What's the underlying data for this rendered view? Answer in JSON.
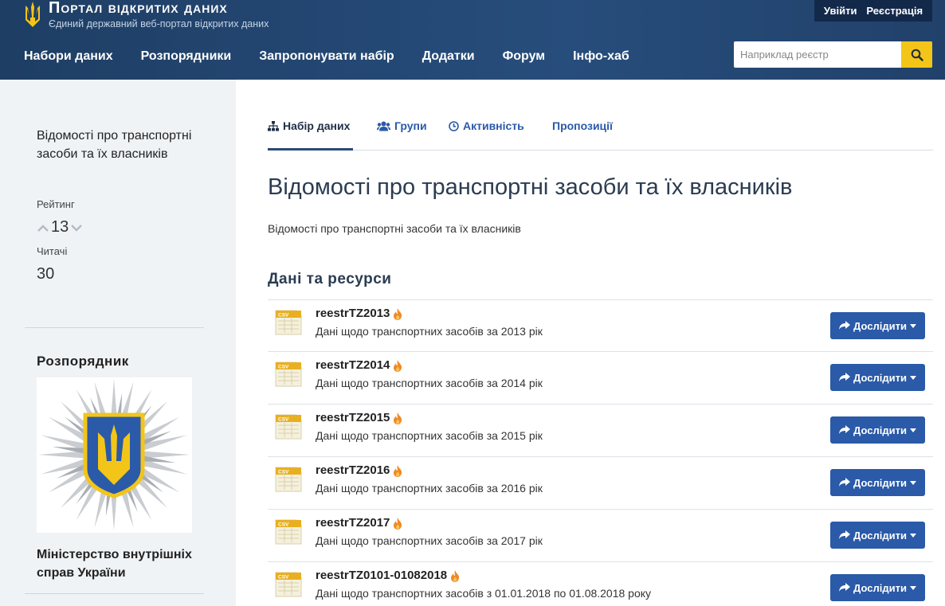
{
  "header": {
    "title": "Портал відкритих даних",
    "subtitle": "Єдиний державний веб-портал відкритих даних",
    "login": "Увійти",
    "register": "Реєстрація",
    "nav": [
      "Набори даних",
      "Розпорядники",
      "Запропонувати набір",
      "Додатки",
      "Форум",
      "Інфо-хаб"
    ],
    "search_placeholder": "Наприклад реєстр"
  },
  "sidebar": {
    "dataset_title": "Відомості про транспортні засоби та їх власників",
    "rating_label": "Рейтинг",
    "rating_value": "13",
    "readers_label": "Читачі",
    "readers_value": "30",
    "publisher_heading": "Розпорядник",
    "publisher_name": "Міністерство внутрішніх справ України"
  },
  "tabs": [
    {
      "label": "Набір даних",
      "icon": "sitemap-icon"
    },
    {
      "label": "Групи",
      "icon": "users-icon"
    },
    {
      "label": "Активність",
      "icon": "clock-icon"
    },
    {
      "label": "Пропозиції",
      "icon": ""
    }
  ],
  "main": {
    "title": "Відомості про транспортні засоби та їх власників",
    "description": "Відомості про транспортні засоби та їх власників",
    "resources_heading": "Дані та ресурси",
    "explore_label": "Дослідити",
    "file_format": "CSV",
    "resources": [
      {
        "name": "reestrTZ2013",
        "desc": "Дані щодо транспортних засобів за 2013 рік"
      },
      {
        "name": "reestrTZ2014",
        "desc": "Дані щодо транспортних засобів за 2014 рік"
      },
      {
        "name": "reestrTZ2015",
        "desc": "Дані щодо транспортних засобів за 2015 рік"
      },
      {
        "name": "reestrTZ2016",
        "desc": "Дані щодо транспортних засобів за 2016 рік"
      },
      {
        "name": "reestrTZ2017",
        "desc": "Дані щодо транспортних засобів за 2017 рік"
      },
      {
        "name": "reestrTZ0101-01082018",
        "desc": "Дані щодо транспортних засобів з 01.01.2018 по 01.08.2018 року"
      }
    ]
  },
  "colors": {
    "header_bg": "#21416a",
    "accent": "#2a5aa8",
    "search_button": "#f2c518",
    "sidebar_bg": "#f0f3f6",
    "flame": "#f08a24"
  }
}
